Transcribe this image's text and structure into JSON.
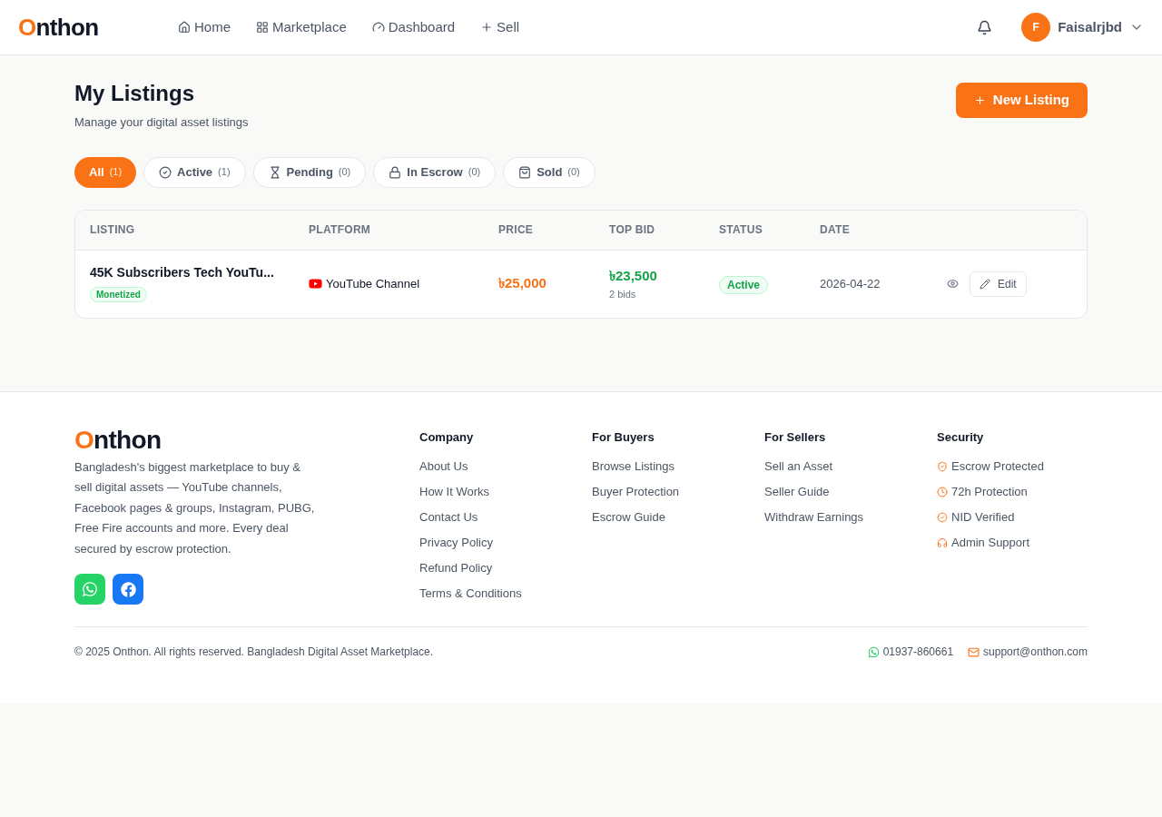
{
  "header": {
    "logo": {
      "accent": "O",
      "rest": "nthon"
    },
    "nav": [
      {
        "kind": "home",
        "label": "Home"
      },
      {
        "kind": "grid",
        "label": "Marketplace"
      },
      {
        "kind": "gauge",
        "label": "Dashboard"
      },
      {
        "kind": "plus",
        "label": "Sell"
      }
    ],
    "user": {
      "initial": "F",
      "name": "Faisalrjbd"
    }
  },
  "page": {
    "title": "My Listings",
    "subtitle": "Manage your digital asset listings",
    "new_button": "New Listing"
  },
  "filters": [
    {
      "kind": "all",
      "label": "All",
      "count": "(1)",
      "selected": true
    },
    {
      "kind": "active",
      "label": "Active",
      "count": "(1)",
      "selected": false
    },
    {
      "kind": "pending",
      "label": "Pending",
      "count": "(0)",
      "selected": false
    },
    {
      "kind": "escrow",
      "label": "In Escrow",
      "count": "(0)",
      "selected": false
    },
    {
      "kind": "sold",
      "label": "Sold",
      "count": "(0)",
      "selected": false
    }
  ],
  "table": {
    "columns": [
      "LISTING",
      "PLATFORM",
      "PRICE",
      "TOP BID",
      "STATUS",
      "DATE"
    ],
    "rows": [
      {
        "title": "45K Subscribers Tech YouTu...",
        "tag": "Monetized",
        "platform": "YouTube Channel",
        "price": "৳25,000",
        "top_bid": "৳23,500",
        "bids": "2 bids",
        "status": "Active",
        "date": "2026-04-22",
        "edit": "Edit"
      }
    ]
  },
  "footer": {
    "logo": {
      "accent": "O",
      "rest": "nthon"
    },
    "about": "Bangladesh's biggest marketplace to buy & sell digital assets — YouTube channels, Facebook pages & groups, Instagram, PUBG, Free Fire accounts and more. Every deal secured by escrow protection.",
    "socials": [
      {
        "kind": "whatsapp"
      },
      {
        "kind": "facebook"
      }
    ],
    "columns": [
      {
        "title": "Company",
        "links": [
          {
            "label": "About Us"
          },
          {
            "label": "How It Works"
          },
          {
            "label": "Contact Us"
          },
          {
            "label": "Privacy Policy"
          },
          {
            "label": "Refund Policy"
          },
          {
            "label": "Terms & Conditions"
          }
        ]
      },
      {
        "title": "For Buyers",
        "links": [
          {
            "label": "Browse Listings"
          },
          {
            "label": "Buyer Protection"
          },
          {
            "label": "Escrow Guide"
          }
        ]
      },
      {
        "title": "For Sellers",
        "links": [
          {
            "label": "Sell an Asset"
          },
          {
            "label": "Seller Guide"
          },
          {
            "label": "Withdraw Earnings"
          }
        ]
      },
      {
        "title": "Security",
        "links": [
          {
            "kind": "shield",
            "label": "Escrow Protected"
          },
          {
            "kind": "clock",
            "label": "72h Protection"
          },
          {
            "kind": "badge",
            "label": "NID Verified"
          },
          {
            "kind": "headphones",
            "label": "Admin Support"
          }
        ]
      }
    ],
    "copyright": "© 2025 Onthon. All rights reserved. Bangladesh Digital Asset Marketplace.",
    "contacts": [
      {
        "kind": "whatsapp",
        "label": "01937-860661"
      },
      {
        "kind": "mail",
        "label": "support@onthon.com"
      }
    ]
  }
}
